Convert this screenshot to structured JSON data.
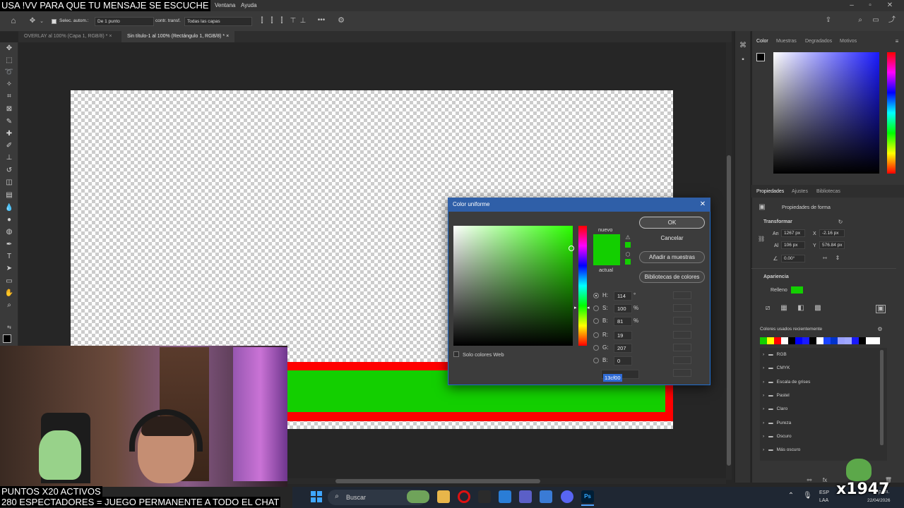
{
  "stream": {
    "ticker": "USA !VV PARA QUE TU MENSAJE SE ESCUCHE",
    "points_line": "PUNTOS X20 ACTIVOS",
    "viewers_line": "280 ESPECTADORES = JUEGO PERMANENTE A TODO EL CHAT",
    "badge": "x1947"
  },
  "menu": {
    "items": [
      "Ventana",
      "Ayuda"
    ]
  },
  "options_bar": {
    "auto_select_label": "Selec. autom.:",
    "layer_mode": "De 1 punto",
    "transform_label": "contr. transf.",
    "layers_select": "Todas las capas"
  },
  "tabs": [
    {
      "label": "OVERLAY al 100% (Capa 1, RGB/8) *",
      "active": false
    },
    {
      "label": "Sin título-1 al 100% (Rectángulo 1, RGB/8) *",
      "active": true
    }
  ],
  "right_panel": {
    "color_tabs": [
      "Color",
      "Muestras",
      "Degradados",
      "Motivos"
    ],
    "props_tabs": [
      "Propiedades",
      "Ajustes",
      "Bibliotecas"
    ],
    "props_title": "Propiedades de forma",
    "transform_header": "Transformar",
    "width_label": "An",
    "width_value": "1267 px",
    "x_label": "X",
    "x_value": "-2.16 px",
    "height_label": "Al",
    "height_value": "106 px",
    "y_label": "Y",
    "y_value": "576.84 px",
    "angle_value": "0.00°",
    "appearance_header": "Apariencia",
    "fill_label": "Relleno",
    "fill_color": "#13cf00",
    "recent_colors_label": "Colores usados recientemente",
    "recent_colors": [
      "#13cf00",
      "#ffff00",
      "#ff0000",
      "#ffffff",
      "#000000",
      "#0000ff",
      "#1a1aff",
      "#000000",
      "#ffffff",
      "#1a44ff",
      "#0033cc",
      "#9aa0ff",
      "#a0a8ff",
      "#1a1aff",
      "#000000",
      "#ffffff",
      "#ffffff"
    ],
    "folders": [
      "RGB",
      "CMYK",
      "Escala de grises",
      "Pastel",
      "Claro",
      "Pureza",
      "Oscuro",
      "Más oscuro"
    ]
  },
  "dialog": {
    "title": "Color uniforme",
    "new_label": "nuevo",
    "current_label": "actual",
    "new_color": "#13cf00",
    "current_color": "#13cf00",
    "buttons": {
      "ok": "OK",
      "cancel": "Cancelar",
      "add_swatch": "Añadir a muestras",
      "libraries": "Bibliotecas de colores"
    },
    "fields": [
      {
        "label": "H:",
        "value": "114",
        "unit": "°",
        "selected": true
      },
      {
        "label": "S:",
        "value": "100",
        "unit": "%",
        "selected": false
      },
      {
        "label": "B:",
        "value": "81",
        "unit": "%",
        "selected": false
      },
      {
        "label": "R:",
        "value": "19",
        "unit": "",
        "selected": false
      },
      {
        "label": "G:",
        "value": "207",
        "unit": "",
        "selected": false
      },
      {
        "label": "B:",
        "value": "0",
        "unit": "",
        "selected": false
      }
    ],
    "hex_label": "#",
    "hex_value": "13cf00",
    "web_only_label": "Solo colores Web"
  },
  "taskbar": {
    "search_placeholder": "Buscar",
    "lang_top": "ESP",
    "lang_bottom": "LAA",
    "time": "3 p. m.",
    "date": "22/04/2026"
  }
}
